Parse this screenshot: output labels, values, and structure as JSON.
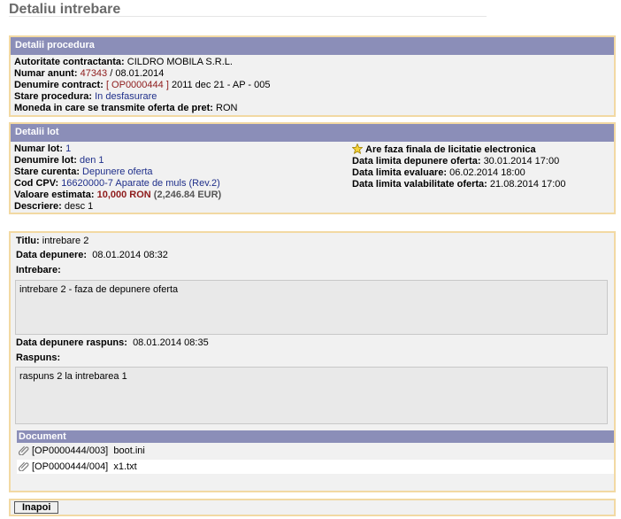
{
  "page_title": "Detaliu intrebare",
  "procedura": {
    "header": "Detalii procedura",
    "autoritate_label": "Autoritate contractanta",
    "autoritate_value": "CILDRO MOBILA S.R.L.",
    "numar_anunt_label": "Numar anunt",
    "numar_anunt_value": "47343",
    "numar_anunt_date": "/ 08.01.2014",
    "denumire_label": "Denumire contract",
    "denumire_code": "[ OP0000444 ]",
    "denumire_value": "2011 dec 21 - AP - 005",
    "stare_label": "Stare procedura",
    "stare_value": "In desfasurare",
    "moneda_label": "Moneda in care se transmite oferta de pret",
    "moneda_value": "RON"
  },
  "lot": {
    "header": "Detalii lot",
    "numar_label": "Numar lot",
    "numar_value": "1",
    "denumire_label": "Denumire lot",
    "denumire_value": "den 1",
    "stare_label": "Stare curenta",
    "stare_value": "Depunere oferta",
    "cpv_label": "Cod CPV",
    "cpv_value": "16620000-7 Aparate de muls (Rev.2)",
    "valoare_label": "Valoare estimata",
    "valoare_ron": "10,000 RON",
    "valoare_eur": "(2,246.84 EUR)",
    "descriere_label": "Descriere",
    "descriere_value": "desc 1",
    "licitatie_text": "Are faza finala de licitatie electronica",
    "depunere_label": "Data limita depunere oferta",
    "depunere_value": "30.01.2014 17:00",
    "evaluare_label": "Data limita evaluare",
    "evaluare_value": "06.02.2014 18:00",
    "valabilitate_label": "Data limita valabilitate oferta",
    "valabilitate_value": "21.08.2014 17:00"
  },
  "intrebare": {
    "titlu_label": "Titlu",
    "titlu_value": "intrebare 2",
    "data_depunere_label": "Data depunere",
    "data_depunere_value": "08.01.2014 08:32",
    "intrebare_label": "Intrebare",
    "intrebare_text": "intrebare 2 - faza de depunere oferta",
    "data_raspuns_label": "Data depunere raspuns",
    "data_raspuns_value": "08.01.2014 08:35",
    "raspuns_label": "Raspuns",
    "raspuns_text": "raspuns 2 la intrebarea 1"
  },
  "documents": {
    "header": "Document",
    "items": [
      {
        "code": "[OP0000444/003]",
        "name": "boot.ini",
        "icon": "paperclip-icon"
      },
      {
        "code": "[OP0000444/004]",
        "name": "x1.txt",
        "icon": "paperclip-icon"
      }
    ]
  },
  "actions": {
    "back_label": "Inapoi"
  },
  "colors": {
    "header_bg": "#8b8eb8",
    "panel_border": "#f2d9a3",
    "panel_bg": "#f1f1f1",
    "link_blue": "#1f2f8a",
    "value_red": "#8e1b1b"
  }
}
